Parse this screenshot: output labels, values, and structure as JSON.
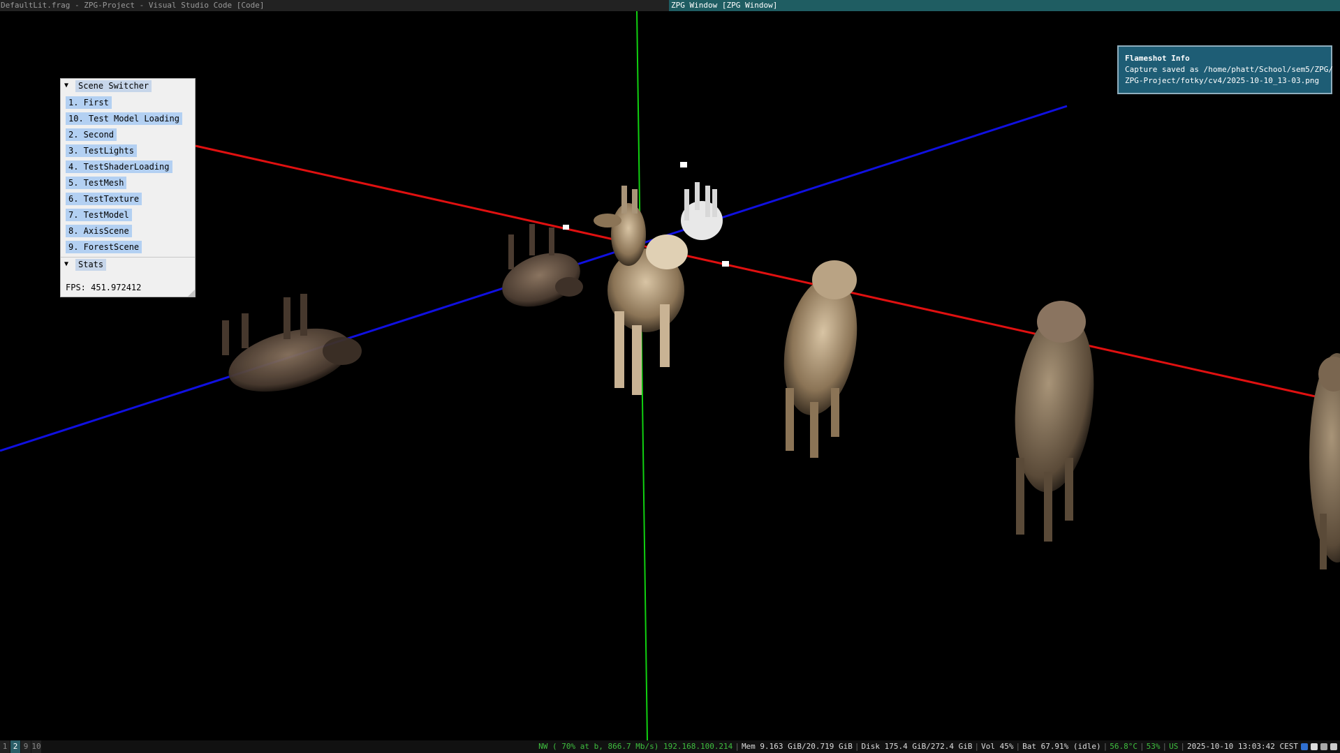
{
  "titlebar": {
    "left": "DefaultLit.frag - ZPG-Project - Visual Studio Code [Code]",
    "right": "ZPG Window [ZPG Window]"
  },
  "scene_switcher": {
    "title": "Scene Switcher",
    "items": [
      "1. First",
      "10. Test Model Loading",
      "2. Second",
      "3. TestLights",
      "4. TestShaderLoading",
      "5. TestMesh",
      "6. TestTexture",
      "7. TestModel",
      "8. AxisScene",
      "9. ForestScene"
    ]
  },
  "stats": {
    "title": "Stats",
    "fps": "FPS: 451.972412"
  },
  "notification": {
    "title": "Flameshot Info",
    "line1": "Capture saved as /home/phatt/School/sem5/ZPG/",
    "line2": "ZPG-Project/fotky/cv4/2025-10-10_13-03.png"
  },
  "workspaces": [
    "1",
    "2",
    "9",
    "10"
  ],
  "active_workspace": "2",
  "statusbar": {
    "network": "NW ( 70% at b, 866.7 Mb/s) 192.168.100.214",
    "memory": "Mem 9.163 GiB/20.719 GiB",
    "disk": "Disk 175.4 GiB/272.4 GiB",
    "volume": "Vol 45%",
    "battery": "Bat 67.91% (idle)",
    "temperature": "56.8°C",
    "cpu": "53%",
    "layout": "US",
    "datetime": "2025-10-10 13:03:42 CEST"
  },
  "colors": {
    "x_axis": "#e01010",
    "y_axis": "#10d010",
    "z_axis": "#1010e0",
    "accent": "#1f5d62"
  },
  "icons": [
    "bluetooth-icon",
    "discord-icon",
    "chat-icon",
    "wifi-icon"
  ]
}
